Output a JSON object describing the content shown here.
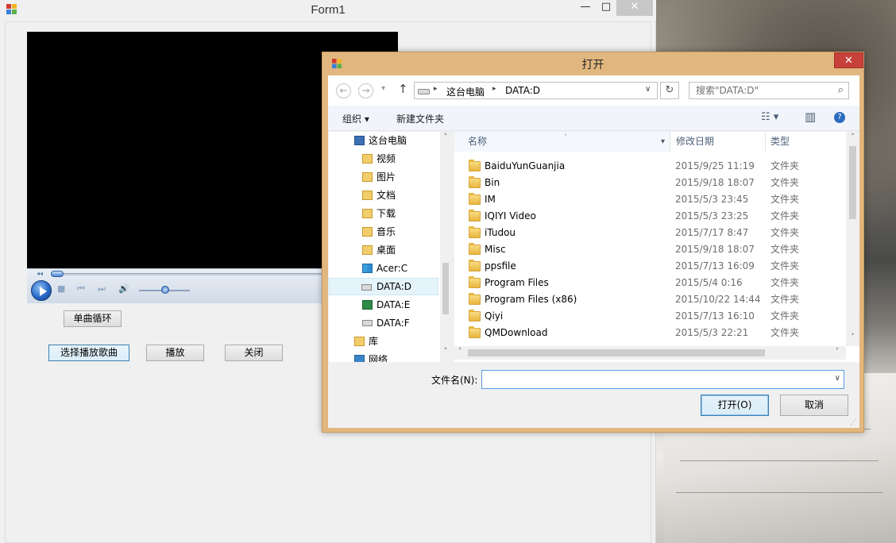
{
  "form1": {
    "title": "Form1",
    "caption": {
      "minimize": "—",
      "maximize": "□",
      "close": "✕"
    },
    "player": {
      "seek_back": "◂◂",
      "stop": "■",
      "prev": "⏮",
      "next": "⏭",
      "volume": "🔊"
    },
    "buttons": {
      "loop": "单曲循环",
      "select_song": "选择播放歌曲",
      "play": "播放",
      "close": "关闭"
    }
  },
  "dialog": {
    "title": "打开",
    "close_glyph": "✕",
    "nav": {
      "back": "←",
      "forward": "→",
      "recent": "▾",
      "up": "↑",
      "breadcrumb": [
        "这台电脑",
        "DATA:D"
      ],
      "sep": "▸",
      "dropdown": "∨",
      "refresh": "↻",
      "search_placeholder": "搜索\"DATA:D\"",
      "search_icon": "⌕"
    },
    "toolbar": {
      "organize": "组织 ▾",
      "new_folder": "新建文件夹",
      "view": "☷ ▾",
      "pane": "▥",
      "help": "?"
    },
    "tree": [
      {
        "label": "这台电脑",
        "icon": "computer-icon"
      },
      {
        "label": "视频",
        "icon": "video-folder-icon"
      },
      {
        "label": "图片",
        "icon": "pictures-folder-icon"
      },
      {
        "label": "文档",
        "icon": "documents-folder-icon"
      },
      {
        "label": "下载",
        "icon": "downloads-folder-icon"
      },
      {
        "label": "音乐",
        "icon": "music-folder-icon"
      },
      {
        "label": "桌面",
        "icon": "desktop-folder-icon"
      },
      {
        "label": "Acer:C",
        "icon": "windows-drive-icon"
      },
      {
        "label": "DATA:D",
        "icon": "drive-icon",
        "selected": true
      },
      {
        "label": "DATA:E",
        "icon": "excel-drive-icon"
      },
      {
        "label": "DATA:F",
        "icon": "drive-icon"
      },
      {
        "label": "库",
        "icon": "library-icon"
      },
      {
        "label": "网络",
        "icon": "network-icon"
      }
    ],
    "columns": {
      "name": "名称",
      "date": "修改日期",
      "type": "类型",
      "sort": "˄",
      "name_menu": "▾"
    },
    "files": [
      {
        "name": "BaiduYunGuanjia",
        "date": "2015/9/25 11:19",
        "type": "文件夹"
      },
      {
        "name": "Bin",
        "date": "2015/9/18 18:07",
        "type": "文件夹"
      },
      {
        "name": "IM",
        "date": "2015/5/3 23:45",
        "type": "文件夹"
      },
      {
        "name": "IQIYI Video",
        "date": "2015/5/3 23:25",
        "type": "文件夹"
      },
      {
        "name": "iTudou",
        "date": "2015/7/17 8:47",
        "type": "文件夹"
      },
      {
        "name": "Misc",
        "date": "2015/9/18 18:07",
        "type": "文件夹"
      },
      {
        "name": "ppsfile",
        "date": "2015/7/13 16:09",
        "type": "文件夹"
      },
      {
        "name": "Program Files",
        "date": "2015/5/4 0:16",
        "type": "文件夹"
      },
      {
        "name": "Program Files (x86)",
        "date": "2015/10/22 14:44",
        "type": "文件夹"
      },
      {
        "name": "Qiyi",
        "date": "2015/7/13 16:10",
        "type": "文件夹"
      },
      {
        "name": "QMDownload",
        "date": "2015/5/3 22:21",
        "type": "文件夹"
      }
    ],
    "scroll": {
      "up": "˄",
      "down": "˅",
      "left": "˂",
      "right": "˃"
    },
    "filename_label": "文件名(N):",
    "filename_value": "",
    "filename_dropdown": "∨",
    "open_button": "打开(O)",
    "cancel_button": "取消",
    "grip": "⋰"
  }
}
